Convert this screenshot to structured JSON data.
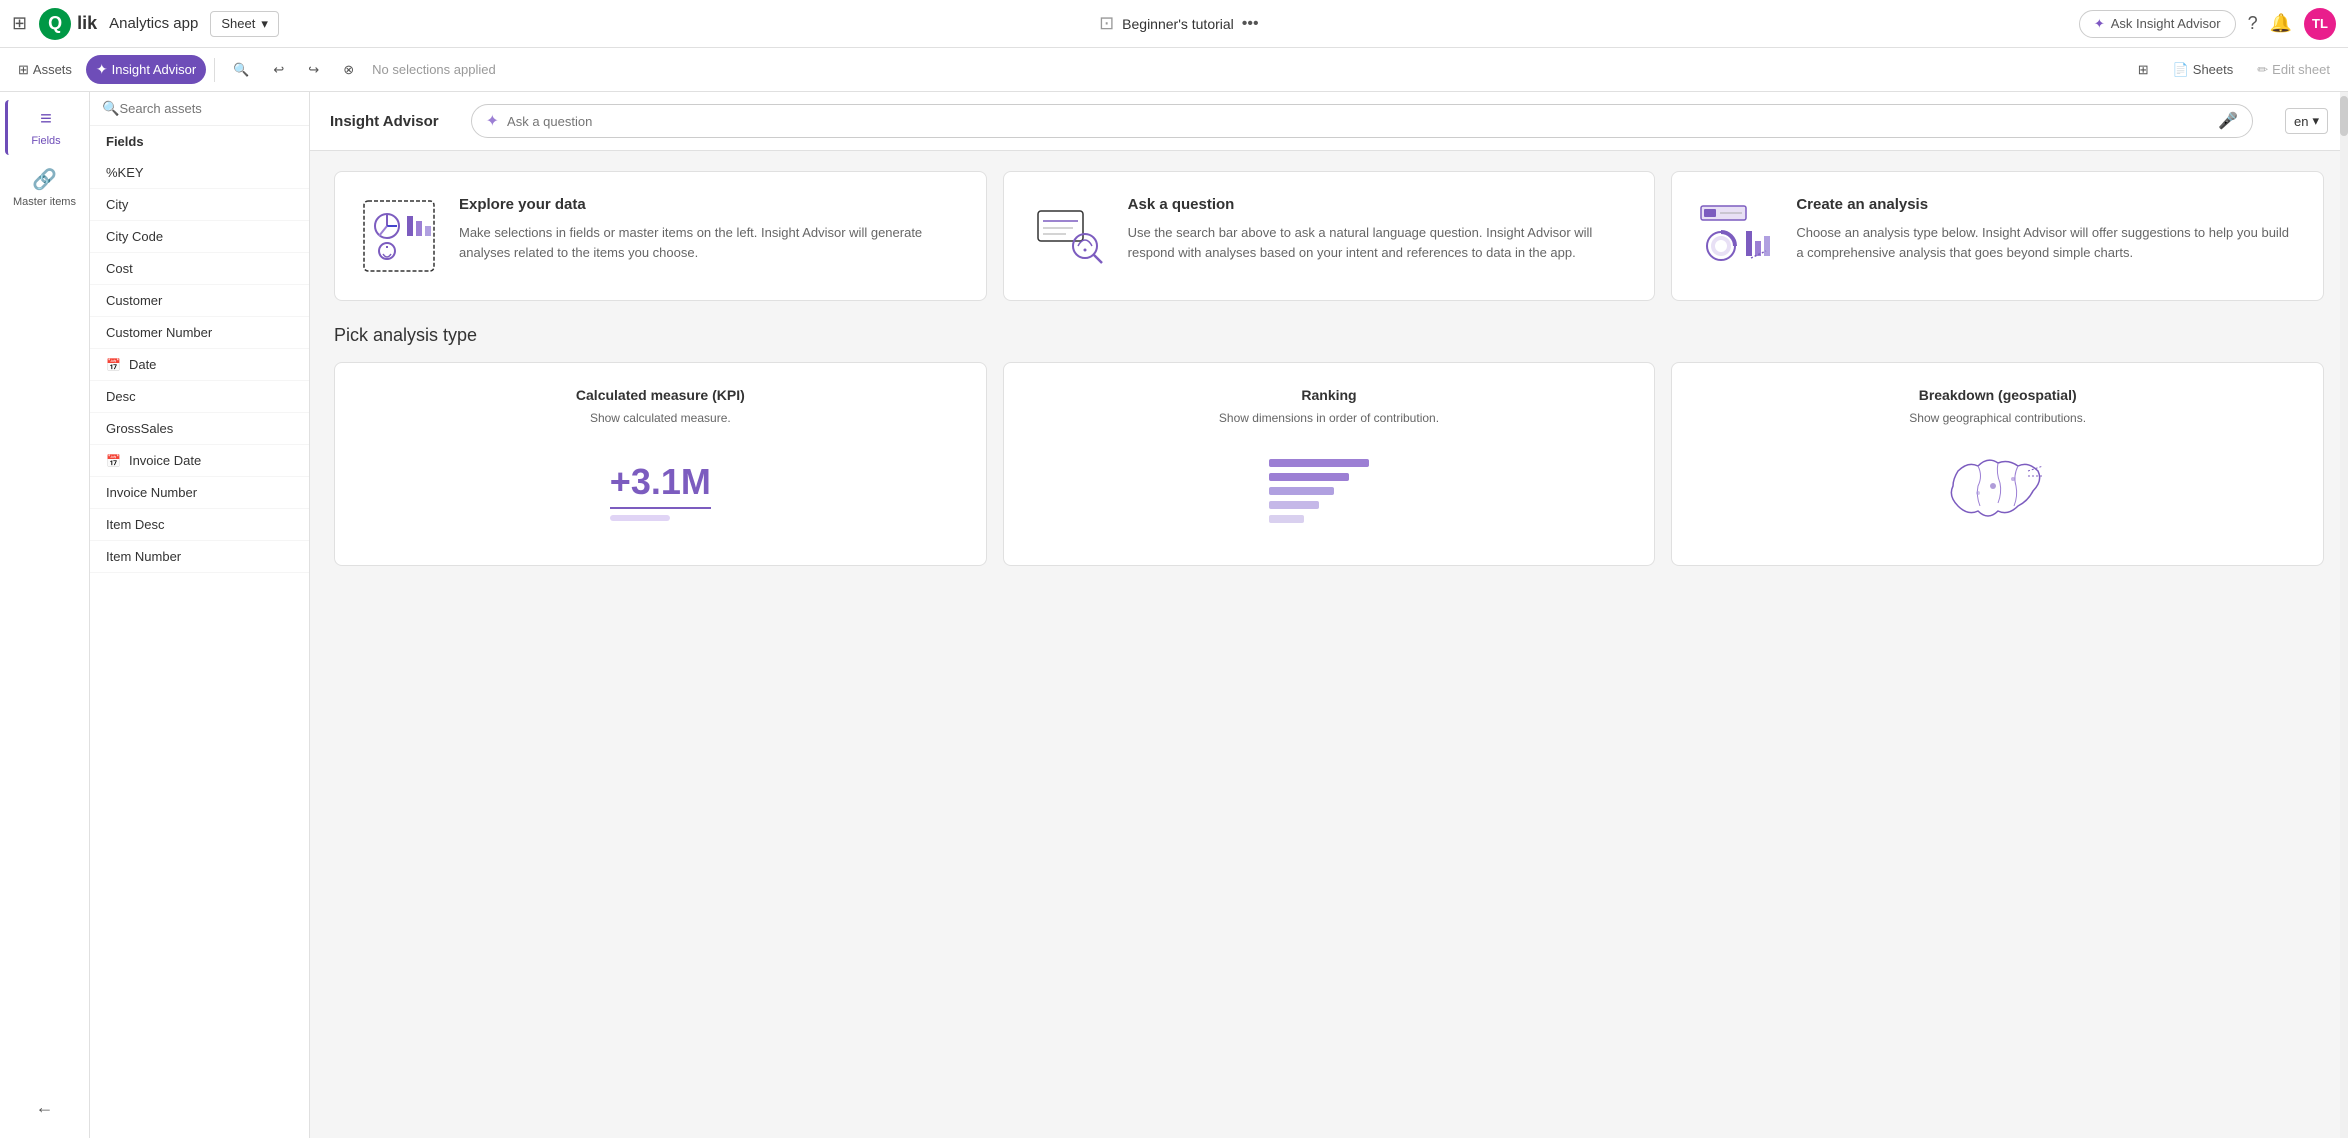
{
  "topNav": {
    "appTitle": "Analytics app",
    "dropdownLabel": "Sheet",
    "tutorialLabel": "Beginner's tutorial",
    "askInsightBtn": "Ask Insight Advisor",
    "avatarInitials": "TL"
  },
  "toolbar": {
    "assetsLabel": "Assets",
    "insightAdvisorLabel": "Insight Advisor",
    "noSelections": "No selections applied",
    "sheetsLabel": "Sheets",
    "editSheetLabel": "Edit sheet"
  },
  "leftPanel": {
    "fieldsLabel": "Fields",
    "masterItemsLabel": "Master items"
  },
  "sidePanel": {
    "title": "Insight Advisor",
    "searchPlaceholder": "Search assets",
    "fieldsLabel": "Fields",
    "fields": [
      {
        "name": "%KEY",
        "hasIcon": false
      },
      {
        "name": "City",
        "hasIcon": false
      },
      {
        "name": "City Code",
        "hasIcon": false
      },
      {
        "name": "Cost",
        "hasIcon": false
      },
      {
        "name": "Customer",
        "hasIcon": false
      },
      {
        "name": "Customer Number",
        "hasIcon": false
      },
      {
        "name": "Date",
        "hasIcon": true
      },
      {
        "name": "Desc",
        "hasIcon": false
      },
      {
        "name": "GrossSales",
        "hasIcon": false
      },
      {
        "name": "Invoice Date",
        "hasIcon": true
      },
      {
        "name": "Invoice Number",
        "hasIcon": false
      },
      {
        "name": "Item Desc",
        "hasIcon": false
      },
      {
        "name": "Item Number",
        "hasIcon": false
      }
    ]
  },
  "askBar": {
    "placeholder": "Ask a question",
    "language": "en"
  },
  "cards": [
    {
      "title": "Explore your data",
      "description": "Make selections in fields or master items on the left. Insight Advisor will generate analyses related to the items you choose."
    },
    {
      "title": "Ask a question",
      "description": "Use the search bar above to ask a natural language question. Insight Advisor will respond with analyses based on your intent and references to data in the app."
    },
    {
      "title": "Create an analysis",
      "description": "Choose an analysis type below. Insight Advisor will offer suggestions to help you build a comprehensive analysis that goes beyond simple charts."
    }
  ],
  "analysisSection": {
    "title": "Pick analysis type",
    "types": [
      {
        "name": "Calculated measure (KPI)",
        "description": "Show calculated measure.",
        "kpiValue": "+3.1M"
      },
      {
        "name": "Ranking",
        "description": "Show dimensions in order of contribution."
      },
      {
        "name": "Breakdown (geospatial)",
        "description": "Show geographical contributions."
      }
    ]
  }
}
